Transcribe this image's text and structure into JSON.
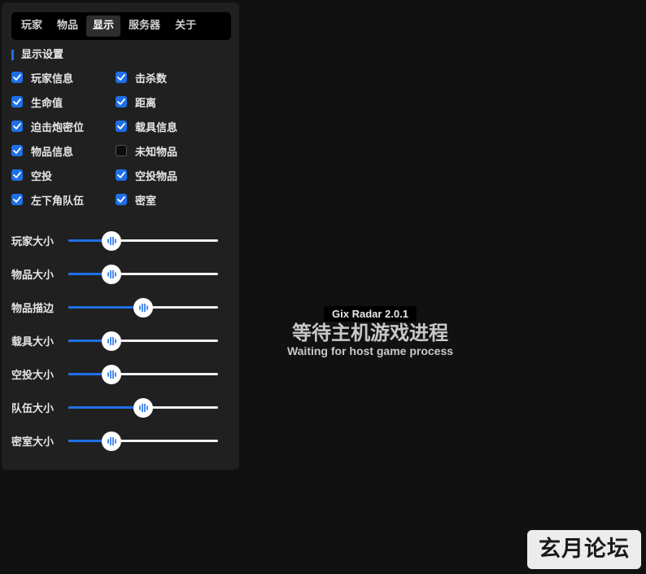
{
  "tabs": [
    {
      "label": "玩家",
      "active": false
    },
    {
      "label": "物品",
      "active": false
    },
    {
      "label": "显示",
      "active": true
    },
    {
      "label": "服务器",
      "active": false
    },
    {
      "label": "关于",
      "active": false
    }
  ],
  "section_title": "显示设置",
  "checkboxes": [
    {
      "label": "玩家信息",
      "checked": true
    },
    {
      "label": "击杀数",
      "checked": true
    },
    {
      "label": "生命值",
      "checked": true
    },
    {
      "label": "距离",
      "checked": true
    },
    {
      "label": "迫击炮密位",
      "checked": true
    },
    {
      "label": "载具信息",
      "checked": true
    },
    {
      "label": "物品信息",
      "checked": true
    },
    {
      "label": "未知物品",
      "checked": false
    },
    {
      "label": "空投",
      "checked": true
    },
    {
      "label": "空投物品",
      "checked": true
    },
    {
      "label": "左下角队伍",
      "checked": true
    },
    {
      "label": "密室",
      "checked": true
    }
  ],
  "sliders": [
    {
      "label": "玩家大小",
      "level": 0.29
    },
    {
      "label": "物品大小",
      "level": 0.29
    },
    {
      "label": "物品描边",
      "level": 0.5
    },
    {
      "label": "载具大小",
      "level": 0.29
    },
    {
      "label": "空投大小",
      "level": 0.29
    },
    {
      "label": "队伍大小",
      "level": 0.5
    },
    {
      "label": "密室大小",
      "level": 0.29
    }
  ],
  "status": {
    "version": "Gix Radar 2.0.1",
    "message_cn": "等待主机游戏进程",
    "message_en": "Waiting for host game process"
  },
  "watermark": "玄月论坛",
  "colors": {
    "accent": "#1e6fe8",
    "background": "#111111",
    "panel": "#202020"
  }
}
